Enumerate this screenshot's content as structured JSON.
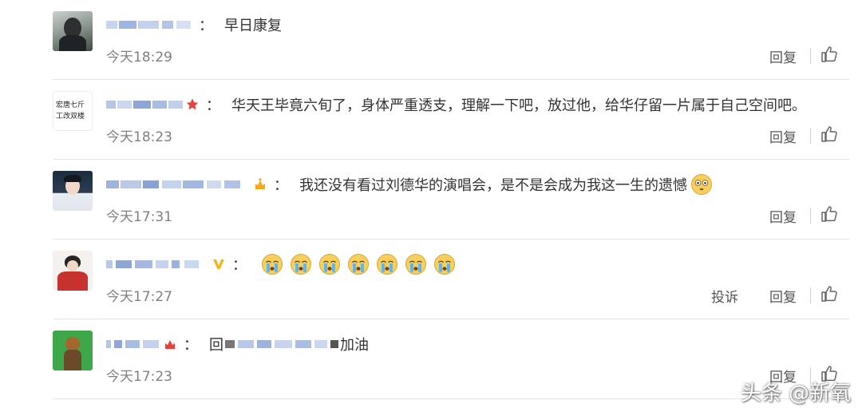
{
  "comments": [
    {
      "content": "早日康复",
      "time": "今天18:29",
      "reply_label": "回复"
    },
    {
      "content": "华天王毕竟六旬了，身体严重透支，理解一下吧，放过他，给华仔留一片属于自己空间吧。",
      "time": "今天18:23",
      "reply_label": "回复",
      "avatar_text": "宏唐七斤 工改双楼"
    },
    {
      "content": "我还没有看过刘德华的演唱会，是不是会成为我这一生的遗憾",
      "time": "今天17:31",
      "reply_label": "回复"
    },
    {
      "content": "",
      "time": "今天17:27",
      "reply_label": "回复",
      "report_label": "投诉",
      "emoji_count": 7,
      "emoji_name": "crying-face-icon"
    },
    {
      "content_prefix": "回",
      "content_suffix": "加油",
      "time": "今天17:23",
      "reply_label": "回复"
    }
  ],
  "watermark": "头条 @新氧",
  "colors": {
    "time": "#808080",
    "badge_red": "#e8423a",
    "badge_orange": "#f5a623",
    "vip_gold": "#f3b51b",
    "divider": "#e6e6e6"
  }
}
